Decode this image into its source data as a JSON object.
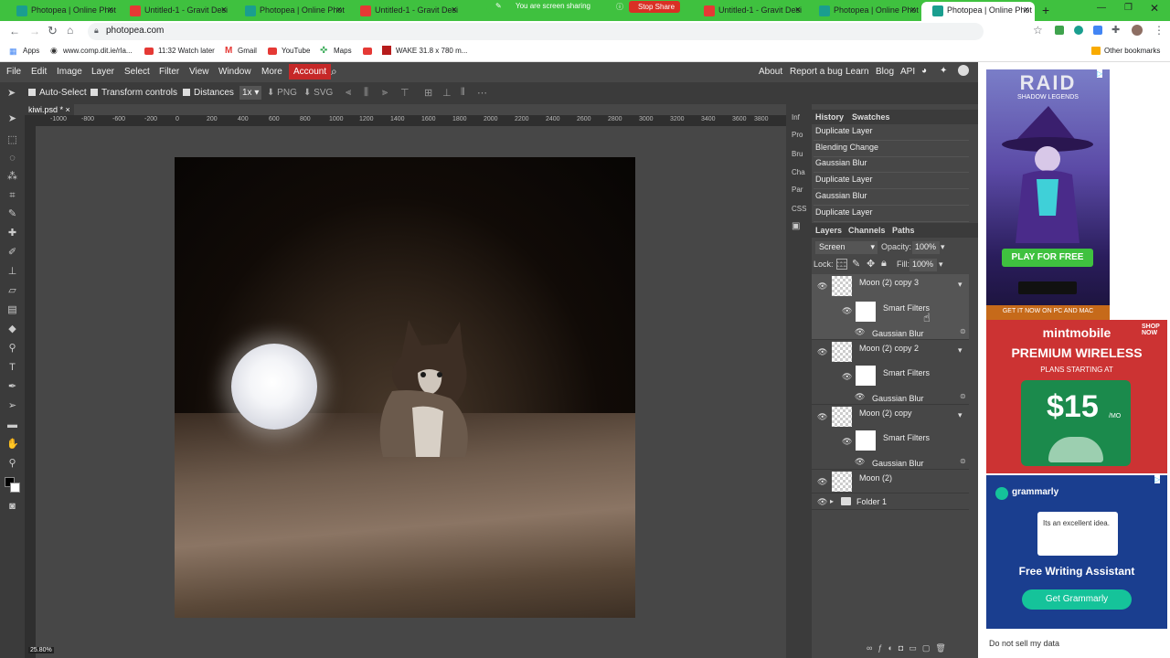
{
  "browser": {
    "tabs": [
      {
        "label": "Photopea | Online Phot",
        "favicon_color": "#1a9e8f"
      },
      {
        "label": "Untitled-1 - Gravit Desi",
        "favicon_color": "#e53935"
      },
      {
        "label": "Photopea | Online Phot",
        "favicon_color": "#1a9e8f"
      },
      {
        "label": "Untitled-1 - Gravit Desi",
        "favicon_color": "#e53935"
      },
      {
        "label": "Untitled-1 - Gravit Desi",
        "favicon_color": "#e53935"
      },
      {
        "label": "Photopea | Online Phot",
        "favicon_color": "#1a9e8f"
      },
      {
        "label": "Photopea | Online Phot",
        "favicon_color": "#1a9e8f"
      }
    ],
    "screen_share_text": "You are screen sharing",
    "stop_share_label": "Stop Share",
    "url": "photopea.com",
    "bookmarks": [
      "Apps",
      "www.comp.dit.ie/rla...",
      "11:32 Watch later",
      "Gmail",
      "YouTube",
      "Maps",
      "WAKE 31.8 x 780 m..."
    ],
    "other_bookmarks": "Other bookmarks"
  },
  "menubar": {
    "items": [
      "File",
      "Edit",
      "Image",
      "Layer",
      "Select",
      "Filter",
      "View",
      "Window",
      "More"
    ],
    "account": "Account",
    "right_items": [
      "About",
      "Report a bug",
      "Learn",
      "Blog",
      "API"
    ]
  },
  "options": {
    "auto_select": "Auto-Select",
    "transform_controls": "Transform controls",
    "distances": "Distances",
    "zoom": "1x",
    "png": "PNG",
    "svg": "SVG"
  },
  "document": {
    "tab_label": "kiwi.psd *",
    "ruler_ticks": [
      "-1000",
      "-800",
      "-600",
      "-400",
      "-200",
      "0",
      "200",
      "400",
      "600",
      "800",
      "1000",
      "1200",
      "1400",
      "1600",
      "1800",
      "2000",
      "2200",
      "2400",
      "2600",
      "2800",
      "3000",
      "3200",
      "3400",
      "3600",
      "3800"
    ],
    "zoom_level": "25.80%"
  },
  "side_icons": [
    "Inf",
    "Pro",
    "Bru",
    "Cha",
    "Par",
    "CSS"
  ],
  "history": {
    "tabs": [
      "History",
      "Swatches"
    ],
    "items": [
      "Duplicate Layer",
      "Blending Change",
      "Gaussian Blur",
      "Duplicate Layer",
      "Gaussian Blur",
      "Duplicate Layer"
    ]
  },
  "layers": {
    "tabs": [
      "Layers",
      "Channels",
      "Paths"
    ],
    "blend_mode": "Screen",
    "opacity_label": "Opacity:",
    "opacity": "100%",
    "lock_label": "Lock:",
    "fill_label": "Fill:",
    "fill": "100%",
    "rows": [
      {
        "name": "Moon (2) copy 3",
        "smart_filters": "Smart Filters",
        "filter": "Gaussian Blur"
      },
      {
        "name": "Moon (2) copy 2",
        "smart_filters": "Smart Filters",
        "filter": "Gaussian Blur"
      },
      {
        "name": "Moon (2) copy",
        "smart_filters": "Smart Filters",
        "filter": "Gaussian Blur"
      },
      {
        "name": "Moon (2)"
      },
      {
        "name": "Folder 1"
      }
    ]
  },
  "ads": {
    "raid_title": "RAID",
    "raid_sub": "SHADOW LEGENDS",
    "raid_cta": "PLAY FOR FREE",
    "raid_foot": "GET IT NOW ON PC AND MAC",
    "mint_brand": "mintmobile",
    "mint_title": "PREMIUM WIRELESS",
    "mint_sub": "PLANS STARTING AT",
    "mint_price": "$15",
    "mint_per": "/MO",
    "mint_shop": "SHOP NOW",
    "gram_brand": "grammarly",
    "gram_card": "Its an excellent idea.",
    "gram_title": "Free Writing Assistant",
    "gram_cta": "Get Grammarly",
    "do_not_sell": "Do not sell my data"
  }
}
